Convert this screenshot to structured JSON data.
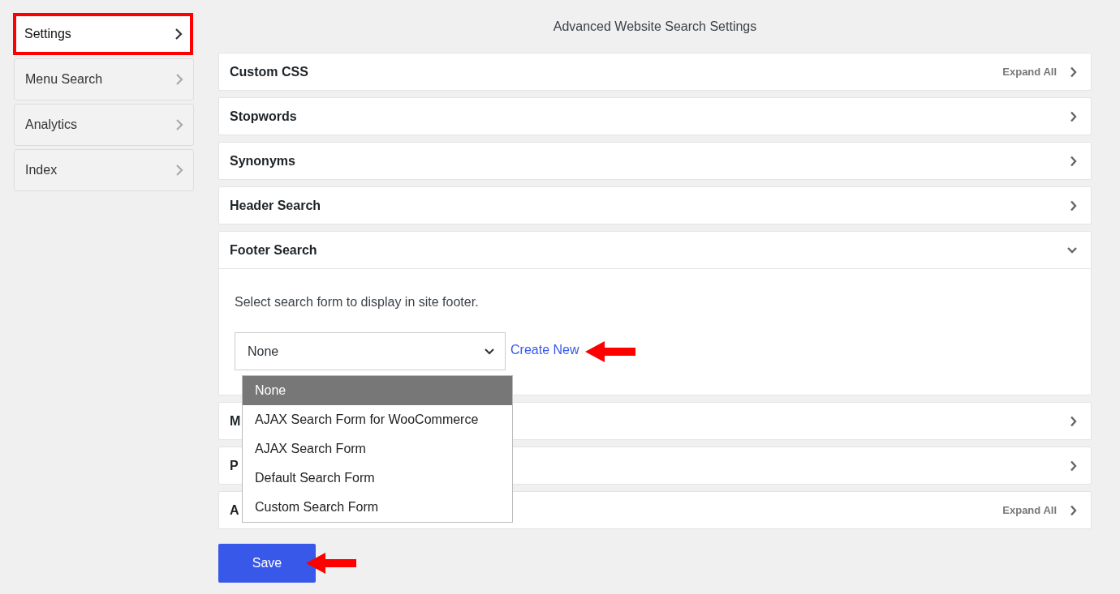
{
  "sidebar": {
    "items": [
      {
        "label": "Settings",
        "selected": true,
        "highlighted": true
      },
      {
        "label": "Menu Search",
        "selected": false,
        "highlighted": false
      },
      {
        "label": "Analytics",
        "selected": false,
        "highlighted": false
      },
      {
        "label": "Index",
        "selected": false,
        "highlighted": false
      }
    ]
  },
  "page_title": "Advanced Website Search Settings",
  "sections": [
    {
      "title": "Custom CSS",
      "expanded": false,
      "action": "Expand All"
    },
    {
      "title": "Stopwords",
      "expanded": false
    },
    {
      "title": "Synonyms",
      "expanded": false
    },
    {
      "title": "Header Search",
      "expanded": false
    },
    {
      "title": "Footer Search",
      "expanded": true,
      "body": {
        "description": "Select search form to display in site footer.",
        "select": {
          "value": "None",
          "open": true,
          "options": [
            {
              "label": "None",
              "selected": true
            },
            {
              "label": "AJAX Search Form for WooCommerce",
              "selected": false
            },
            {
              "label": "AJAX Search Form",
              "selected": false
            },
            {
              "label": "Default Search Form",
              "selected": false
            },
            {
              "label": "Custom Search Form",
              "selected": false
            }
          ]
        },
        "link": {
          "label": "Create New",
          "arrow": true
        }
      }
    },
    {
      "title": "M",
      "expanded": false
    },
    {
      "title": "P",
      "expanded": false
    },
    {
      "title": "A",
      "expanded": false,
      "action": "Expand All"
    }
  ],
  "save_button": {
    "label": "Save",
    "arrow": true
  }
}
